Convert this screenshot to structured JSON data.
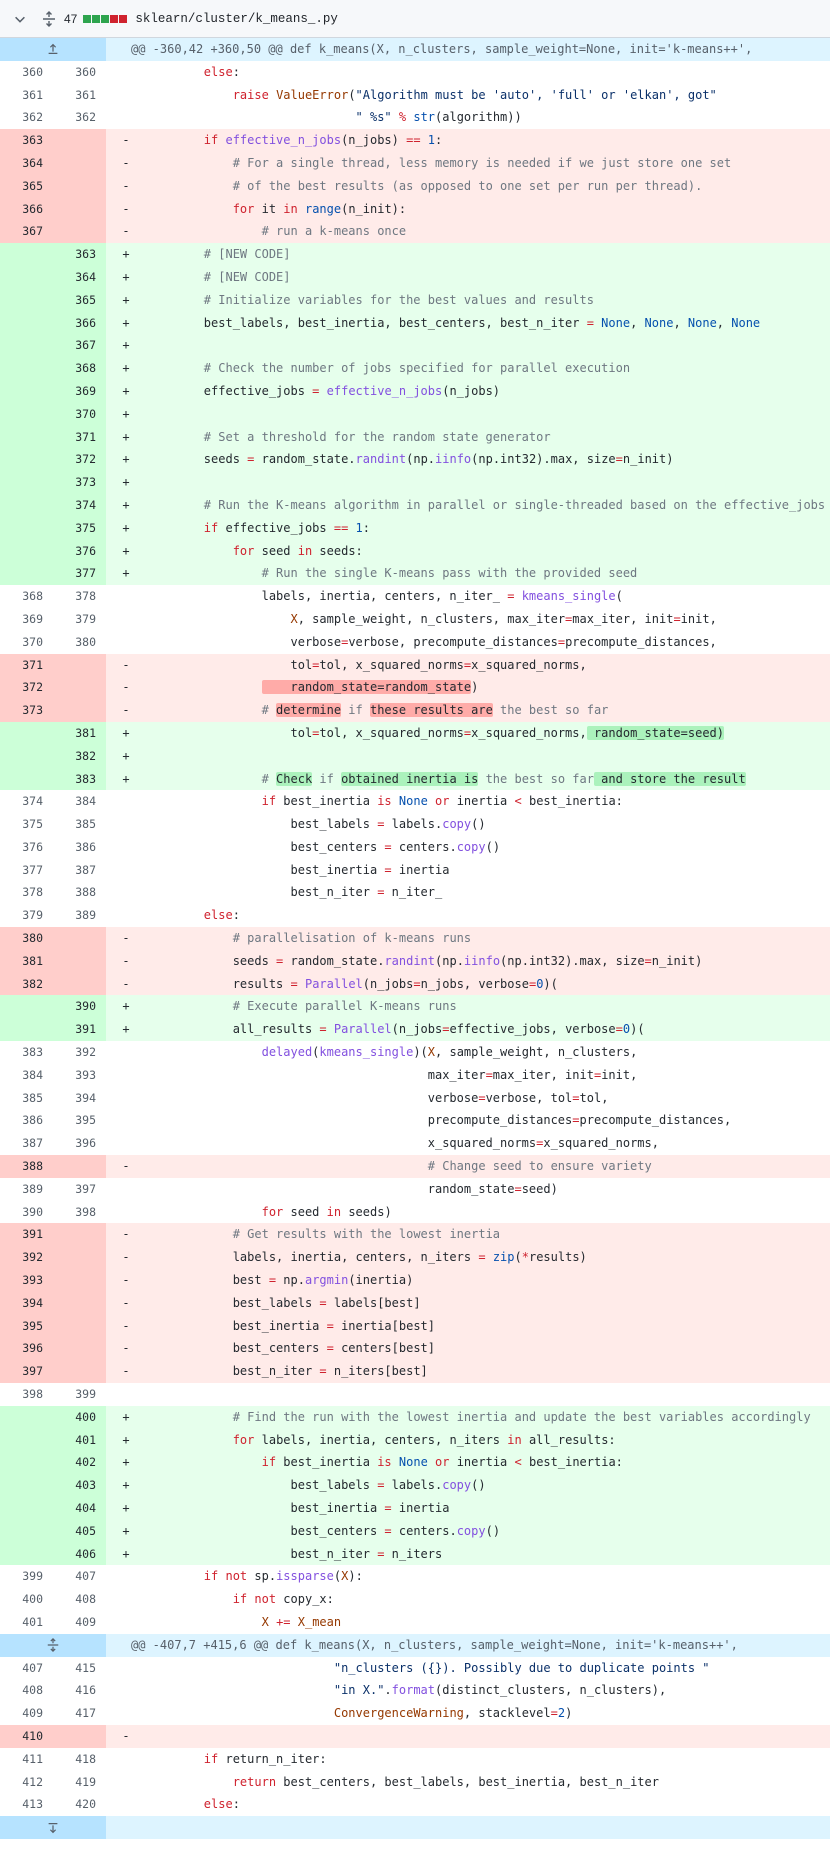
{
  "file": {
    "changes": "47",
    "stat_blocks": [
      "a",
      "a",
      "a",
      "d",
      "d"
    ],
    "path": "sklearn/cluster/k_means_.py"
  },
  "lines": [
    {
      "t": "hunk",
      "text": "@@ -360,42 +360,50 @@ def k_means(X, n_clusters, sample_weight=None, init='k-means++',",
      "expand": "up"
    },
    {
      "t": "ctx",
      "o": "360",
      "n": "360",
      "c": "        [[kw:else]]:"
    },
    {
      "t": "ctx",
      "o": "361",
      "n": "361",
      "c": "            [[kw:raise]] [[cls:ValueError]]([[st:\"Algorithm must be 'auto', 'full' or 'elkan', got\"]]"
    },
    {
      "t": "ctx",
      "o": "362",
      "n": "362",
      "c": "                             [[st:\" %s\"]] [[kw:%]] [[bi:str]](algorithm))"
    },
    {
      "t": "del",
      "o": "363",
      "n": "",
      "c": "        [[kw:if]] [[fn:effective_n_jobs]](n_jobs) [[kw:==]] [[bi:1]]:"
    },
    {
      "t": "del",
      "o": "364",
      "n": "",
      "c": "            [[cm:# For a single thread, less memory is needed if we just store one set]]"
    },
    {
      "t": "del",
      "o": "365",
      "n": "",
      "c": "            [[cm:# of the best results (as opposed to one set per run per thread).]]"
    },
    {
      "t": "del",
      "o": "366",
      "n": "",
      "c": "            [[kw:for]] it [[kw:in]] [[bi:range]](n_init):"
    },
    {
      "t": "del",
      "o": "367",
      "n": "",
      "c": "                [[cm:# run a k-means once]]"
    },
    {
      "t": "add",
      "o": "",
      "n": "363",
      "c": "        [[cm:# [NEW CODE]]]"
    },
    {
      "t": "add",
      "o": "",
      "n": "364",
      "c": "        [[cm:# [NEW CODE]]]"
    },
    {
      "t": "add",
      "o": "",
      "n": "365",
      "c": "        [[cm:# Initialize variables for the best values and results]]"
    },
    {
      "t": "add",
      "o": "",
      "n": "366",
      "c": "        best_labels, best_inertia, best_centers, best_n_iter [[kw:=]] [[bi:None]], [[bi:None]], [[bi:None]], [[bi:None]]"
    },
    {
      "t": "add",
      "o": "",
      "n": "367",
      "c": ""
    },
    {
      "t": "add",
      "o": "",
      "n": "368",
      "c": "        [[cm:# Check the number of jobs specified for parallel execution]]"
    },
    {
      "t": "add",
      "o": "",
      "n": "369",
      "c": "        effective_jobs [[kw:=]] [[fn:effective_n_jobs]](n_jobs)"
    },
    {
      "t": "add",
      "o": "",
      "n": "370",
      "c": ""
    },
    {
      "t": "add",
      "o": "",
      "n": "371",
      "c": "        [[cm:# Set a threshold for the random state generator]]"
    },
    {
      "t": "add",
      "o": "",
      "n": "372",
      "c": "        seeds [[kw:=]] random_state.[[fn:randint]](np.[[fn:iinfo]](np.int32).max, size[[kw:=]]n_init)"
    },
    {
      "t": "add",
      "o": "",
      "n": "373",
      "c": ""
    },
    {
      "t": "add",
      "o": "",
      "n": "374",
      "c": "        [[cm:# Run the K-means algorithm in parallel or single-threaded based on the effective_jobs]]"
    },
    {
      "t": "add",
      "o": "",
      "n": "375",
      "c": "        [[kw:if]] effective_jobs [[kw:==]] [[bi:1]]:"
    },
    {
      "t": "add",
      "o": "",
      "n": "376",
      "c": "            [[kw:for]] seed [[kw:in]] seeds:"
    },
    {
      "t": "add",
      "o": "",
      "n": "377",
      "c": "                [[cm:# Run the single K-means pass with the provided seed]]"
    },
    {
      "t": "ctx",
      "o": "368",
      "n": "378",
      "c": "                labels, inertia, centers, n_iter_ [[kw:=]] [[fn:kmeans_single]]("
    },
    {
      "t": "ctx",
      "o": "369",
      "n": "379",
      "c": "                    [[cls:X]], sample_weight, n_clusters, max_iter[[kw:=]]max_iter, init[[kw:=]]init,"
    },
    {
      "t": "ctx",
      "o": "370",
      "n": "380",
      "c": "                    verbose[[kw:=]]verbose, precompute_distances[[kw:=]]precompute_distances,"
    },
    {
      "t": "del",
      "o": "371",
      "n": "",
      "c": "                    tol[[kw:=]]tol, x_squared_norms[[kw:=]]x_squared_norms,"
    },
    {
      "t": "del",
      "o": "372",
      "n": "",
      "c": "                [[hlD:    random_state=random_state]])"
    },
    {
      "t": "del",
      "o": "373",
      "n": "",
      "c": "                [[cm:# ]][[hlD:determine]][[cm: if ]][[hlD:these results are]][[cm: the best so far]]"
    },
    {
      "t": "add",
      "o": "",
      "n": "381",
      "c": "                    tol[[kw:=]]tol, x_squared_norms[[kw:=]]x_squared_norms,[[hlA: random_state=seed)]]"
    },
    {
      "t": "add",
      "o": "",
      "n": "382",
      "c": ""
    },
    {
      "t": "add",
      "o": "",
      "n": "383",
      "c": "                [[cm:# ]][[hlA:Check]][[cm: if ]][[hlA:obtained inertia is]][[cm: the best so far]][[hlA: and store the result]]"
    },
    {
      "t": "ctx",
      "o": "374",
      "n": "384",
      "c": "                [[kw:if]] best_inertia [[kw:is]] [[bi:None]] [[kw:or]] inertia [[kw:<]] best_inertia:"
    },
    {
      "t": "ctx",
      "o": "375",
      "n": "385",
      "c": "                    best_labels [[kw:=]] labels.[[fn:copy]]()"
    },
    {
      "t": "ctx",
      "o": "376",
      "n": "386",
      "c": "                    best_centers [[kw:=]] centers.[[fn:copy]]()"
    },
    {
      "t": "ctx",
      "o": "377",
      "n": "387",
      "c": "                    best_inertia [[kw:=]] inertia"
    },
    {
      "t": "ctx",
      "o": "378",
      "n": "388",
      "c": "                    best_n_iter [[kw:=]] n_iter_"
    },
    {
      "t": "ctx",
      "o": "379",
      "n": "389",
      "c": "        [[kw:else]]:"
    },
    {
      "t": "del",
      "o": "380",
      "n": "",
      "c": "            [[cm:# parallelisation of k-means runs]]"
    },
    {
      "t": "del",
      "o": "381",
      "n": "",
      "c": "            seeds [[kw:=]] random_state.[[fn:randint]](np.[[fn:iinfo]](np.int32).max, size[[kw:=]]n_init)"
    },
    {
      "t": "del",
      "o": "382",
      "n": "",
      "c": "            results [[kw:=]] [[fn:Parallel]](n_jobs[[kw:=]]n_jobs, verbose[[kw:=]][[bi:0]])("
    },
    {
      "t": "add",
      "o": "",
      "n": "390",
      "c": "            [[cm:# Execute parallel K-means runs]]"
    },
    {
      "t": "add",
      "o": "",
      "n": "391",
      "c": "            all_results [[kw:=]] [[fn:Parallel]](n_jobs[[kw:=]]effective_jobs, verbose[[kw:=]][[bi:0]])("
    },
    {
      "t": "ctx",
      "o": "383",
      "n": "392",
      "c": "                [[fn:delayed]]([[fn:kmeans_single]])([[cls:X]], sample_weight, n_clusters,"
    },
    {
      "t": "ctx",
      "o": "384",
      "n": "393",
      "c": "                                       max_iter[[kw:=]]max_iter, init[[kw:=]]init,"
    },
    {
      "t": "ctx",
      "o": "385",
      "n": "394",
      "c": "                                       verbose[[kw:=]]verbose, tol[[kw:=]]tol,"
    },
    {
      "t": "ctx",
      "o": "386",
      "n": "395",
      "c": "                                       precompute_distances[[kw:=]]precompute_distances,"
    },
    {
      "t": "ctx",
      "o": "387",
      "n": "396",
      "c": "                                       x_squared_norms[[kw:=]]x_squared_norms,"
    },
    {
      "t": "del",
      "o": "388",
      "n": "",
      "c": "                                       [[cm:# Change seed to ensure variety]]"
    },
    {
      "t": "ctx",
      "o": "389",
      "n": "397",
      "c": "                                       random_state[[kw:=]]seed)"
    },
    {
      "t": "ctx",
      "o": "390",
      "n": "398",
      "c": "                [[kw:for]] seed [[kw:in]] seeds)"
    },
    {
      "t": "del",
      "o": "391",
      "n": "",
      "c": "            [[cm:# Get results with the lowest inertia]]"
    },
    {
      "t": "del",
      "o": "392",
      "n": "",
      "c": "            labels, inertia, centers, n_iters [[kw:=]] [[bi:zip]]([[kw:*]]results)"
    },
    {
      "t": "del",
      "o": "393",
      "n": "",
      "c": "            best [[kw:=]] np.[[fn:argmin]](inertia)"
    },
    {
      "t": "del",
      "o": "394",
      "n": "",
      "c": "            best_labels [[kw:=]] labels[best]"
    },
    {
      "t": "del",
      "o": "395",
      "n": "",
      "c": "            best_inertia [[kw:=]] inertia[best]"
    },
    {
      "t": "del",
      "o": "396",
      "n": "",
      "c": "            best_centers [[kw:=]] centers[best]"
    },
    {
      "t": "del",
      "o": "397",
      "n": "",
      "c": "            best_n_iter [[kw:=]] n_iters[best]"
    },
    {
      "t": "ctx",
      "o": "398",
      "n": "399",
      "c": ""
    },
    {
      "t": "add",
      "o": "",
      "n": "400",
      "c": "            [[cm:# Find the run with the lowest inertia and update the best variables accordingly]]"
    },
    {
      "t": "add",
      "o": "",
      "n": "401",
      "c": "            [[kw:for]] labels, inertia, centers, n_iters [[kw:in]] all_results:"
    },
    {
      "t": "add",
      "o": "",
      "n": "402",
      "c": "                [[kw:if]] best_inertia [[kw:is]] [[bi:None]] [[kw:or]] inertia [[kw:<]] best_inertia:"
    },
    {
      "t": "add",
      "o": "",
      "n": "403",
      "c": "                    best_labels [[kw:=]] labels.[[fn:copy]]()"
    },
    {
      "t": "add",
      "o": "",
      "n": "404",
      "c": "                    best_inertia [[kw:=]] inertia"
    },
    {
      "t": "add",
      "o": "",
      "n": "405",
      "c": "                    best_centers [[kw:=]] centers.[[fn:copy]]()"
    },
    {
      "t": "add",
      "o": "",
      "n": "406",
      "c": "                    best_n_iter [[kw:=]] n_iters"
    },
    {
      "t": "ctx",
      "o": "399",
      "n": "407",
      "c": "        [[kw:if]] [[kw:not]] sp.[[fn:issparse]]([[cls:X]]):"
    },
    {
      "t": "ctx",
      "o": "400",
      "n": "408",
      "c": "            [[kw:if]] [[kw:not]] copy_x:"
    },
    {
      "t": "ctx",
      "o": "401",
      "n": "409",
      "c": "                [[cls:X]] [[kw:+=]] [[cls:X_mean]]"
    },
    {
      "t": "hunk",
      "text": "@@ -407,7 +415,6 @@ def k_means(X, n_clusters, sample_weight=None, init='k-means++',",
      "expand": "both"
    },
    {
      "t": "ctx",
      "o": "407",
      "n": "415",
      "c": "                          [[st:\"n_clusters ({}). Possibly due to duplicate points \"]]"
    },
    {
      "t": "ctx",
      "o": "408",
      "n": "416",
      "c": "                          [[st:\"in X.\"]].[[fn:format]](distinct_clusters, n_clusters),"
    },
    {
      "t": "ctx",
      "o": "409",
      "n": "417",
      "c": "                          [[cls:ConvergenceWarning]], stacklevel[[kw:=]][[bi:2]])"
    },
    {
      "t": "del",
      "o": "410",
      "n": "",
      "c": ""
    },
    {
      "t": "ctx",
      "o": "411",
      "n": "418",
      "c": "        [[kw:if]] return_n_iter:"
    },
    {
      "t": "ctx",
      "o": "412",
      "n": "419",
      "c": "            [[kw:return]] best_centers, best_labels, best_inertia, best_n_iter"
    },
    {
      "t": "ctx",
      "o": "413",
      "n": "420",
      "c": "        [[kw:else]]:"
    },
    {
      "t": "hunk",
      "text": "",
      "expand": "down"
    }
  ]
}
